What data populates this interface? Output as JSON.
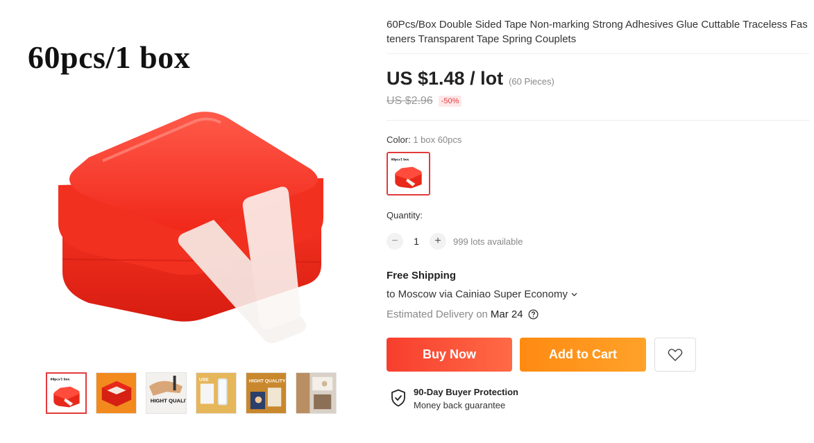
{
  "gallery": {
    "main_overlay_text": "60pcs/1 box",
    "thumb_overlay_text": "60pcs/1 box",
    "thumb_captions": [
      "HIGHT QUALITY",
      "USE",
      "HIGHT QUALITY"
    ],
    "active_index": 0,
    "thumbnail_count": 6
  },
  "product": {
    "title": "60Pcs/Box Double Sided Tape Non-marking Strong Adhesives Glue Cuttable Traceless Fasteners Transparent Tape Spring Couplets",
    "price": "US $1.48 / lot",
    "pieces": "(60 Pieces)",
    "original_price": "US $2.96",
    "discount": "-50%"
  },
  "color": {
    "label": "Color:",
    "value": "1 box 60pcs"
  },
  "quantity": {
    "label": "Quantity:",
    "value": "1",
    "minus": "−",
    "plus": "+",
    "available": "999 lots available"
  },
  "shipping": {
    "title": "Free Shipping",
    "route": "to Moscow via Cainiao Super Economy",
    "estimated_label": "Estimated Delivery on",
    "estimated_date": "Mar 24"
  },
  "actions": {
    "buy_now": "Buy Now",
    "add_to_cart": "Add to Cart"
  },
  "protection": {
    "title": "90-Day Buyer Protection",
    "subtitle": "Money back guarantee"
  },
  "colors": {
    "brand_red": "#e4393c",
    "buy_gradient_start": "#f73e2e",
    "cart_gradient_start": "#ff8a12",
    "product_red": "#f02d1f"
  }
}
